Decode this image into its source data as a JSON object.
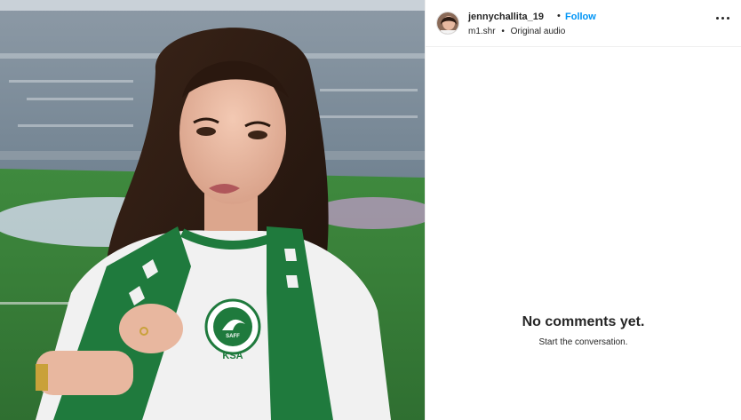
{
  "post": {
    "author": {
      "username": "jennychallita_19",
      "avatar_icon": "profile-avatar"
    },
    "follow_label": "Follow",
    "audio": {
      "creator": "m1.shr",
      "track": "Original audio"
    },
    "separator": "•",
    "more_icon": "more-options-icon"
  },
  "media": {
    "jersey_text": "KSA",
    "crest_text": "SAFF"
  },
  "comments": {
    "empty_title": "No comments yet.",
    "empty_subtitle": "Start the conversation."
  },
  "colors": {
    "follow": "#0095f6",
    "text": "#262626",
    "divider": "#efefef",
    "scarf_green": "#1f7a3d"
  }
}
